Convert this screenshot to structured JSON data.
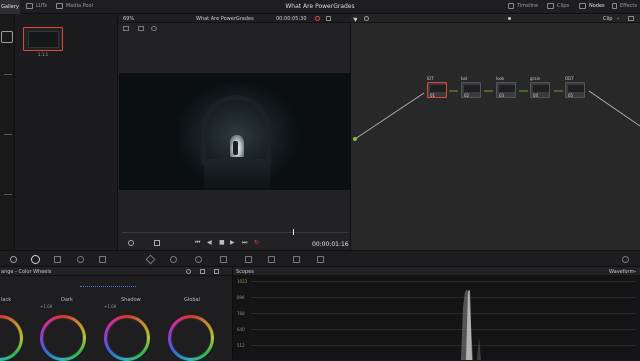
{
  "topbar": {
    "gallery": "Gallery",
    "luts": "LUTs",
    "media_pool": "Media Pool",
    "title": "What Are PowerGrades",
    "timeline": "Timeline",
    "clips": "Clips",
    "nodes": "Nodes",
    "effects": "Effects"
  },
  "viewer": {
    "zoom": "69%",
    "clip_name": "What Are PowerGrades",
    "timecode_top": "00:00:05:30",
    "timecode_bottom": "00:00:01:16"
  },
  "gallery": {
    "still_label": "1.1.1"
  },
  "nodes_panel": {
    "mode": "Clip",
    "nodes": [
      {
        "name": "IDT",
        "number": "01"
      },
      {
        "name": "bal",
        "number": "02"
      },
      {
        "name": "look",
        "number": "03"
      },
      {
        "name": "grain",
        "number": "04"
      },
      {
        "name": "ODT",
        "number": "05"
      }
    ]
  },
  "color_wheels": {
    "header": "ange - Color Wheels",
    "wheels": [
      {
        "label": "lack",
        "value": ""
      },
      {
        "label": "Dark",
        "value": "+1.00"
      },
      {
        "label": "Shadow",
        "value": "+1.00"
      },
      {
        "label": "Global",
        "value": ""
      }
    ]
  },
  "scopes": {
    "title": "Scopes",
    "mode": "Waveform",
    "ticks": [
      "1023",
      "896",
      "768",
      "640",
      "512"
    ]
  },
  "colors": {
    "accent_red": "#d9473c",
    "link_green": "#7bbf3a",
    "link_blue": "#3b7dd8"
  }
}
